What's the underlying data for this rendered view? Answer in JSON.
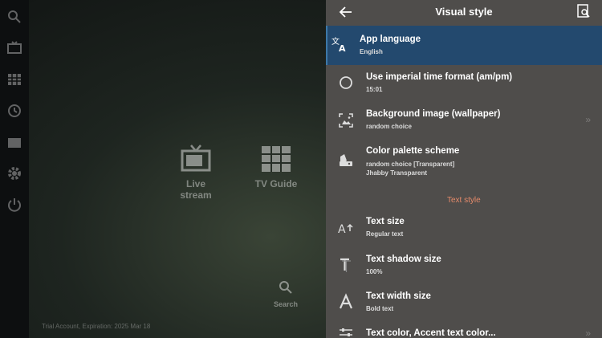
{
  "background": {
    "tiles": [
      {
        "label": "Live stream"
      },
      {
        "label": "TV Guide"
      },
      {
        "label": "Search"
      }
    ],
    "trial_text": "Trial Account, Expiration: 2025 Mar 18"
  },
  "panel": {
    "title": "Visual style",
    "items": [
      {
        "title": "App language",
        "subtitle": "English",
        "icon": "translate-icon"
      },
      {
        "title": "Use imperial time format (am/pm)",
        "subtitle": "15:01",
        "icon": "radio-circle-icon"
      },
      {
        "title": "Background image (wallpaper)",
        "subtitle": "random choice",
        "icon": "wallpaper-icon"
      },
      {
        "title": "Color palette scheme",
        "subtitle": "random choice [Transparent]",
        "subtitle2": "Jhabby Transparent",
        "icon": "palette-icon"
      },
      {
        "title": "Text size",
        "subtitle": "Regular text",
        "icon": "text-size-icon"
      },
      {
        "title": "Text shadow size",
        "subtitle": "100%",
        "icon": "text-shadow-icon"
      },
      {
        "title": "Text width size",
        "subtitle": "Bold text",
        "icon": "text-width-icon"
      },
      {
        "title": "Text color, Accent text color...",
        "icon": "sliders-icon"
      }
    ],
    "section_label": "Text style"
  },
  "colors": {
    "panel_bg": "#4f4d4b",
    "selected_bg": "#23496e",
    "section_accent": "#e58a6a"
  }
}
